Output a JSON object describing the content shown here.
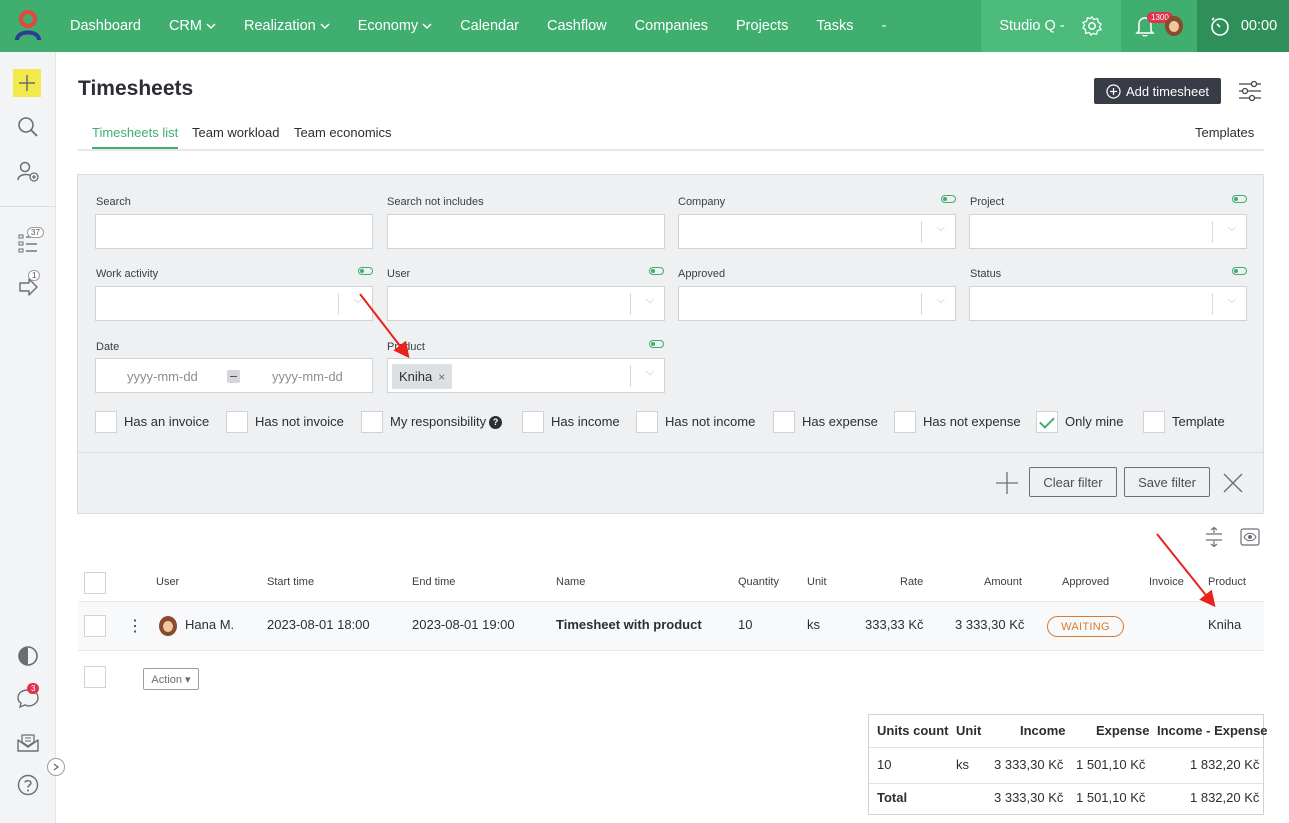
{
  "nav": {
    "items": [
      {
        "label": "Dashboard",
        "dropdown": false
      },
      {
        "label": "CRM",
        "dropdown": true
      },
      {
        "label": "Realization",
        "dropdown": true
      },
      {
        "label": "Economy",
        "dropdown": true
      },
      {
        "label": "Calendar",
        "dropdown": false
      },
      {
        "label": "Cashflow",
        "dropdown": false
      },
      {
        "label": "Companies",
        "dropdown": false
      },
      {
        "label": "Projects",
        "dropdown": false
      },
      {
        "label": "Tasks",
        "dropdown": false
      }
    ],
    "more": "-",
    "studio": "Studio Q",
    "studio_caret": "-",
    "notification_count": "1300",
    "timer": "00:00"
  },
  "sidebar": {
    "tasks_badge": "37",
    "delegated_badge": "1",
    "chat_badge": "3"
  },
  "page": {
    "title": "Timesheets",
    "add_button": "Add timesheet",
    "tabs": [
      "Timesheets list",
      "Team workload",
      "Team economics"
    ],
    "active_tab": 0,
    "templates_link": "Templates"
  },
  "filter": {
    "search_label": "Search",
    "search_not_label": "Search not includes",
    "company_label": "Company",
    "project_label": "Project",
    "work_activity_label": "Work activity",
    "user_label": "User",
    "approved_label": "Approved",
    "status_label": "Status",
    "date_label": "Date",
    "date_from_placeholder": "yyyy-mm-dd",
    "date_to_placeholder": "yyyy-mm-dd",
    "product_label": "Product",
    "product_chip": "Kniha",
    "product_chip_remove": "×",
    "checkboxes": [
      {
        "label": "Has an invoice",
        "checked": false
      },
      {
        "label": "Has not invoice",
        "checked": false
      },
      {
        "label": "My responsibility",
        "checked": false
      },
      {
        "label": "Has income",
        "checked": false
      },
      {
        "label": "Has not income",
        "checked": false
      },
      {
        "label": "Has expense",
        "checked": false
      },
      {
        "label": "Has not expense",
        "checked": false
      },
      {
        "label": "Only mine",
        "checked": true
      },
      {
        "label": "Template",
        "checked": false
      }
    ],
    "help_glyph": "?",
    "clear_button": "Clear filter",
    "save_button": "Save filter"
  },
  "table": {
    "columns": [
      "User",
      "Start time",
      "End time",
      "Name",
      "Quantity",
      "Unit",
      "Rate",
      "Amount",
      "Approved",
      "Invoice",
      "Product"
    ],
    "rows": [
      {
        "user": "Hana M.",
        "start": "2023-08-01 18:00",
        "end": "2023-08-01 19:00",
        "name": "Timesheet with product",
        "quantity": "10",
        "unit": "ks",
        "rate": "333,33 Kč",
        "amount": "3 333,30 Kč",
        "approved": "WAITING",
        "invoice": "",
        "product": "Kniha"
      }
    ],
    "action_button": "Action ▾",
    "row_menu_glyph": "⋮"
  },
  "summary": {
    "headers": [
      "Units count",
      "Unit",
      "Income",
      "Expense",
      "Income - Expense"
    ],
    "row": {
      "units": "10",
      "unit": "ks",
      "income": "3 333,30 Kč",
      "expense": "1 501,10 Kč",
      "diff": "1 832,20 Kč"
    },
    "total": {
      "label": "Total",
      "income": "3 333,30 Kč",
      "expense": "1 501,10 Kč",
      "diff": "1 832,20 Kč"
    }
  },
  "colors": {
    "brand_green": "#3fae6e",
    "timer_green": "#2e8f59",
    "dark_button": "#373c47",
    "status_waiting": "#d97a2c",
    "annotation_red": "#e8231e"
  }
}
